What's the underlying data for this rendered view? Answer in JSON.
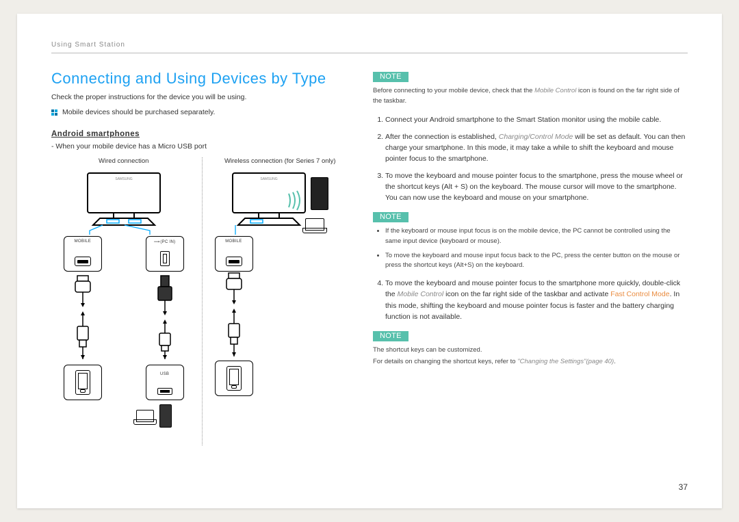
{
  "header": {
    "section": "Using Smart Station"
  },
  "title": "Connecting and Using Devices by Type",
  "intro": "Check the proper instructions for the device you will be using.",
  "purchase_note": "Mobile devices should be purchased separately.",
  "subheading": "Android smartphones",
  "micro_usb_note": "When your mobile device has a Micro USB port",
  "diagram_labels": {
    "wired": "Wired connection",
    "wireless": "Wireless connection (for Series 7 only)",
    "mobile_port": "MOBILE",
    "pc_in_port": "(PC IN)",
    "usb_port": "USB"
  },
  "note_label": "NOTE",
  "note1": {
    "prefix": "Before connecting to your mobile device, check that the ",
    "mono": "Mobile Control",
    "suffix": " icon is found on the far right side of the taskbar."
  },
  "steps123": [
    "Connect your Android smartphone to the Smart Station monitor using the mobile cable.",
    "After the connection is established, Charging/Control Mode will be set as default. You can then charge your smartphone. In this mode, it may take a while to shift the keyboard and mouse pointer focus to the smartphone.",
    "To move the keyboard and mouse pointer focus to the smartphone, press the mouse wheel or the shortcut keys (Alt + S) on the keyboard. The mouse cursor will move to the smartphone. You can now use the keyboard and mouse on your smartphone."
  ],
  "note2_bullets": [
    "If the keyboard or mouse input focus is on the mobile device, the PC cannot be controlled using the same input device (keyboard or mouse).",
    "To move the keyboard and mouse input focus back to the PC, press the center button on the mouse or press the shortcut keys (Alt+S) on the keyboard."
  ],
  "step4": {
    "pre": "To move the keyboard and mouse pointer focus to the smartphone more quickly, double-click the ",
    "mono": "Mobile Control",
    "mid": " icon on the far right side of the taskbar and activate ",
    "orange": "Fast Control Mode",
    "post": ". In this mode, shifting the keyboard and mouse pointer focus is faster and the battery charging function is not available."
  },
  "note3_line1": "The shortcut keys can be customized.",
  "note3_line2_pre": "For details on changing the shortcut keys, refer to ",
  "note3_line2_ref": "\"Changing the Settings\"(page 40)",
  "note3_line2_post": ".",
  "page_number": "37"
}
